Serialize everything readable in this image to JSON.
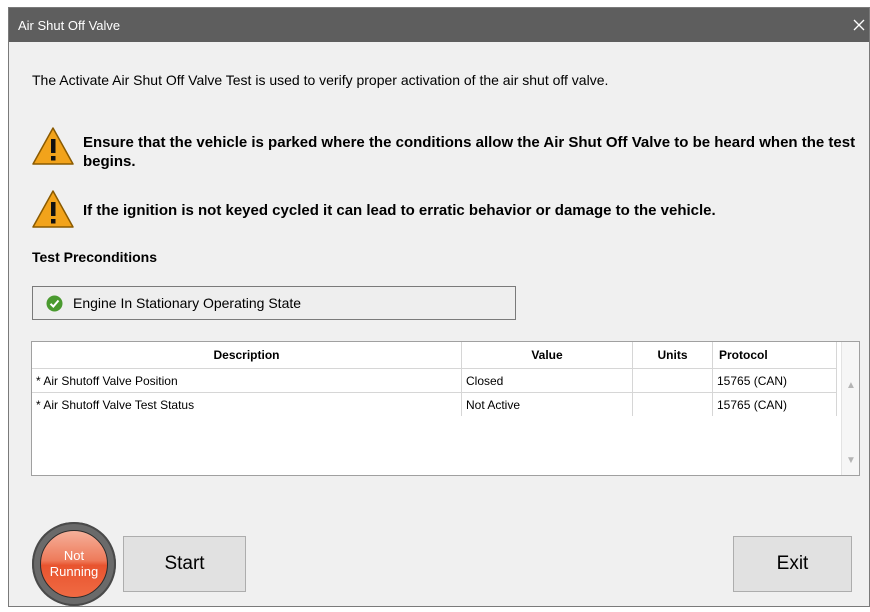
{
  "window": {
    "title": "Air Shut Off Valve",
    "close_glyph": "✕"
  },
  "intro_text": "The Activate Air Shut Off Valve Test is used to verify proper activation of the air shut off valve.",
  "warnings": [
    {
      "text": "Ensure that the vehicle is parked where the conditions allow the Air Shut Off Valve to be heard when the test begins.",
      "icon": "warning-triangle-icon"
    },
    {
      "text": "If the ignition is not keyed cycled it can lead to erratic behavior or damage to the vehicle.",
      "icon": "warning-triangle-icon"
    }
  ],
  "preconditions": {
    "title": "Test Preconditions",
    "items": [
      {
        "label": "Engine In Stationary Operating State",
        "icon": "check-circle-icon",
        "status_color": "#4a9a2f"
      }
    ]
  },
  "table": {
    "columns": [
      "Description",
      "Value",
      "Units",
      "Protocol"
    ],
    "rows": [
      {
        "description": "* Air Shutoff Valve Position",
        "value": "Closed",
        "units": "",
        "protocol": "15765 (CAN)"
      },
      {
        "description": "* Air Shutoff Valve Test Status",
        "value": "Not Active",
        "units": "",
        "protocol": "15765 (CAN)"
      }
    ]
  },
  "status_indicator": {
    "line1": "Not",
    "line2": "Running",
    "color": "#e8542f"
  },
  "buttons": {
    "start": "Start",
    "exit": "Exit"
  },
  "colors": {
    "titlebar": "#5e5e5e",
    "warning": "#f2a31b",
    "background": "#f0f0f0"
  }
}
